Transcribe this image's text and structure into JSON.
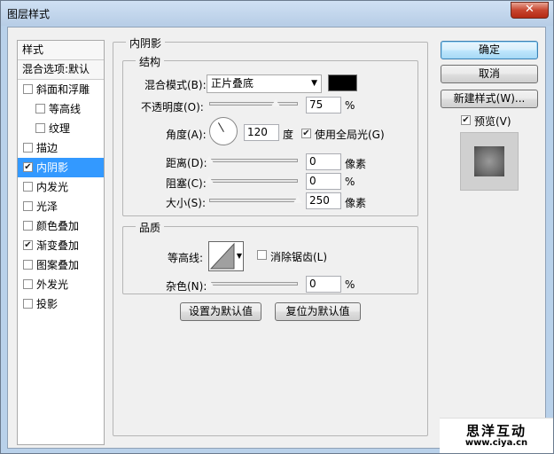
{
  "window": {
    "title": "图层样式",
    "close_label": "✕"
  },
  "sidebar": {
    "header": "样式",
    "blend_options": "混合选项:默认",
    "items": [
      {
        "label": "斜面和浮雕",
        "checked": false,
        "indent": false
      },
      {
        "label": "等高线",
        "checked": false,
        "indent": true
      },
      {
        "label": "纹理",
        "checked": false,
        "indent": true
      },
      {
        "label": "描边",
        "checked": false,
        "indent": false
      },
      {
        "label": "内阴影",
        "checked": true,
        "indent": false,
        "selected": true
      },
      {
        "label": "内发光",
        "checked": false,
        "indent": false
      },
      {
        "label": "光泽",
        "checked": false,
        "indent": false
      },
      {
        "label": "颜色叠加",
        "checked": false,
        "indent": false
      },
      {
        "label": "渐变叠加",
        "checked": true,
        "indent": false
      },
      {
        "label": "图案叠加",
        "checked": false,
        "indent": false
      },
      {
        "label": "外发光",
        "checked": false,
        "indent": false
      },
      {
        "label": "投影",
        "checked": false,
        "indent": false
      }
    ]
  },
  "panel": {
    "title": "内阴影",
    "structure": {
      "title": "结构",
      "blend_mode_label": "混合模式(B):",
      "blend_mode_value": "正片叠底",
      "blend_color": "#000000",
      "opacity_label": "不透明度(O):",
      "opacity_value": "75",
      "opacity_unit": "%",
      "opacity_fraction": 0.75,
      "angle_label": "角度(A):",
      "angle_value": "120",
      "angle_unit": "度",
      "global_light_label": "使用全局光(G)",
      "global_light_checked": true,
      "distance_label": "距离(D):",
      "distance_value": "0",
      "distance_unit": "像素",
      "distance_fraction": 0.0,
      "choke_label": "阻塞(C):",
      "choke_value": "0",
      "choke_unit": "%",
      "choke_fraction": 0.0,
      "size_label": "大小(S):",
      "size_value": "250",
      "size_unit": "像素",
      "size_fraction": 1.0
    },
    "quality": {
      "title": "品质",
      "contour_label": "等高线:",
      "antialias_label": "消除锯齿(L)",
      "antialias_checked": false,
      "noise_label": "杂色(N):",
      "noise_value": "0",
      "noise_unit": "%",
      "noise_fraction": 0.0
    },
    "set_default_label": "设置为默认值",
    "reset_default_label": "复位为默认值"
  },
  "buttons": {
    "ok": "确定",
    "cancel": "取消",
    "new_style": "新建样式(W)...",
    "preview_label": "预览(V)",
    "preview_checked": true
  },
  "watermark": {
    "brand": "思洋互动",
    "url": "www.ciya.cn"
  }
}
